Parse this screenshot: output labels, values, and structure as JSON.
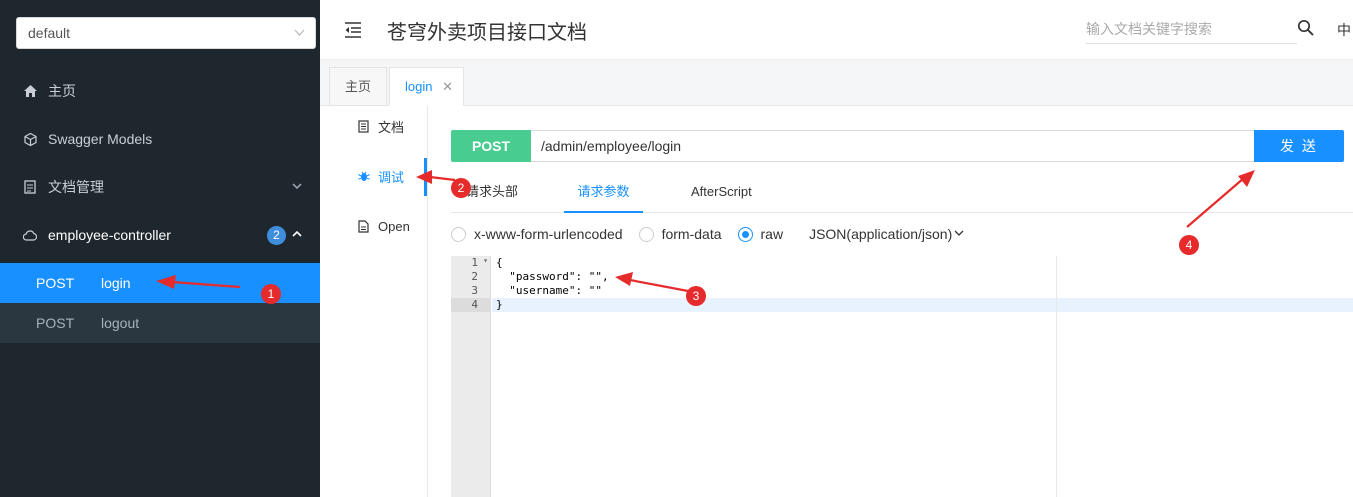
{
  "sidebar": {
    "group_select": "default",
    "items": [
      {
        "label": "主页",
        "icon": "home-icon"
      },
      {
        "label": "Swagger Models",
        "icon": "cube-icon"
      },
      {
        "label": "文档管理",
        "icon": "document-manage-icon"
      },
      {
        "label": "employee-controller",
        "icon": "cloud-icon",
        "badge": "2"
      }
    ],
    "endpoints": [
      {
        "method": "POST",
        "name": "login"
      },
      {
        "method": "POST",
        "name": "logout"
      }
    ]
  },
  "header": {
    "title": "苍穹外卖项目接口文档",
    "search_placeholder": "输入文档关键字搜索",
    "lang": "中"
  },
  "tabs": [
    {
      "label": "主页"
    },
    {
      "label": "login"
    }
  ],
  "left_nav": [
    {
      "label": "文档"
    },
    {
      "label": "调试"
    },
    {
      "label": "Open"
    }
  ],
  "request": {
    "method": "POST",
    "url": "/admin/employee/login",
    "send_label": "发 送"
  },
  "sub_tabs": [
    {
      "label": "请求头部"
    },
    {
      "label": "请求参数"
    },
    {
      "label": "AfterScript"
    }
  ],
  "body_types": {
    "options": [
      "x-www-form-urlencoded",
      "form-data",
      "raw"
    ],
    "selected": "raw",
    "content_type": "JSON(application/json)"
  },
  "editor": {
    "line_numbers": [
      "1",
      "2",
      "3",
      "4"
    ],
    "lines": [
      "{",
      "  \"password\": \"\",",
      "  \"username\": \"\"",
      "}"
    ]
  },
  "annotations": [
    "1",
    "2",
    "3",
    "4"
  ],
  "colors": {
    "sidebar_bg": "#1f272e",
    "active_item": "#1890ff",
    "post_green": "#49cc90",
    "annotation_red": "#e52b2b"
  }
}
